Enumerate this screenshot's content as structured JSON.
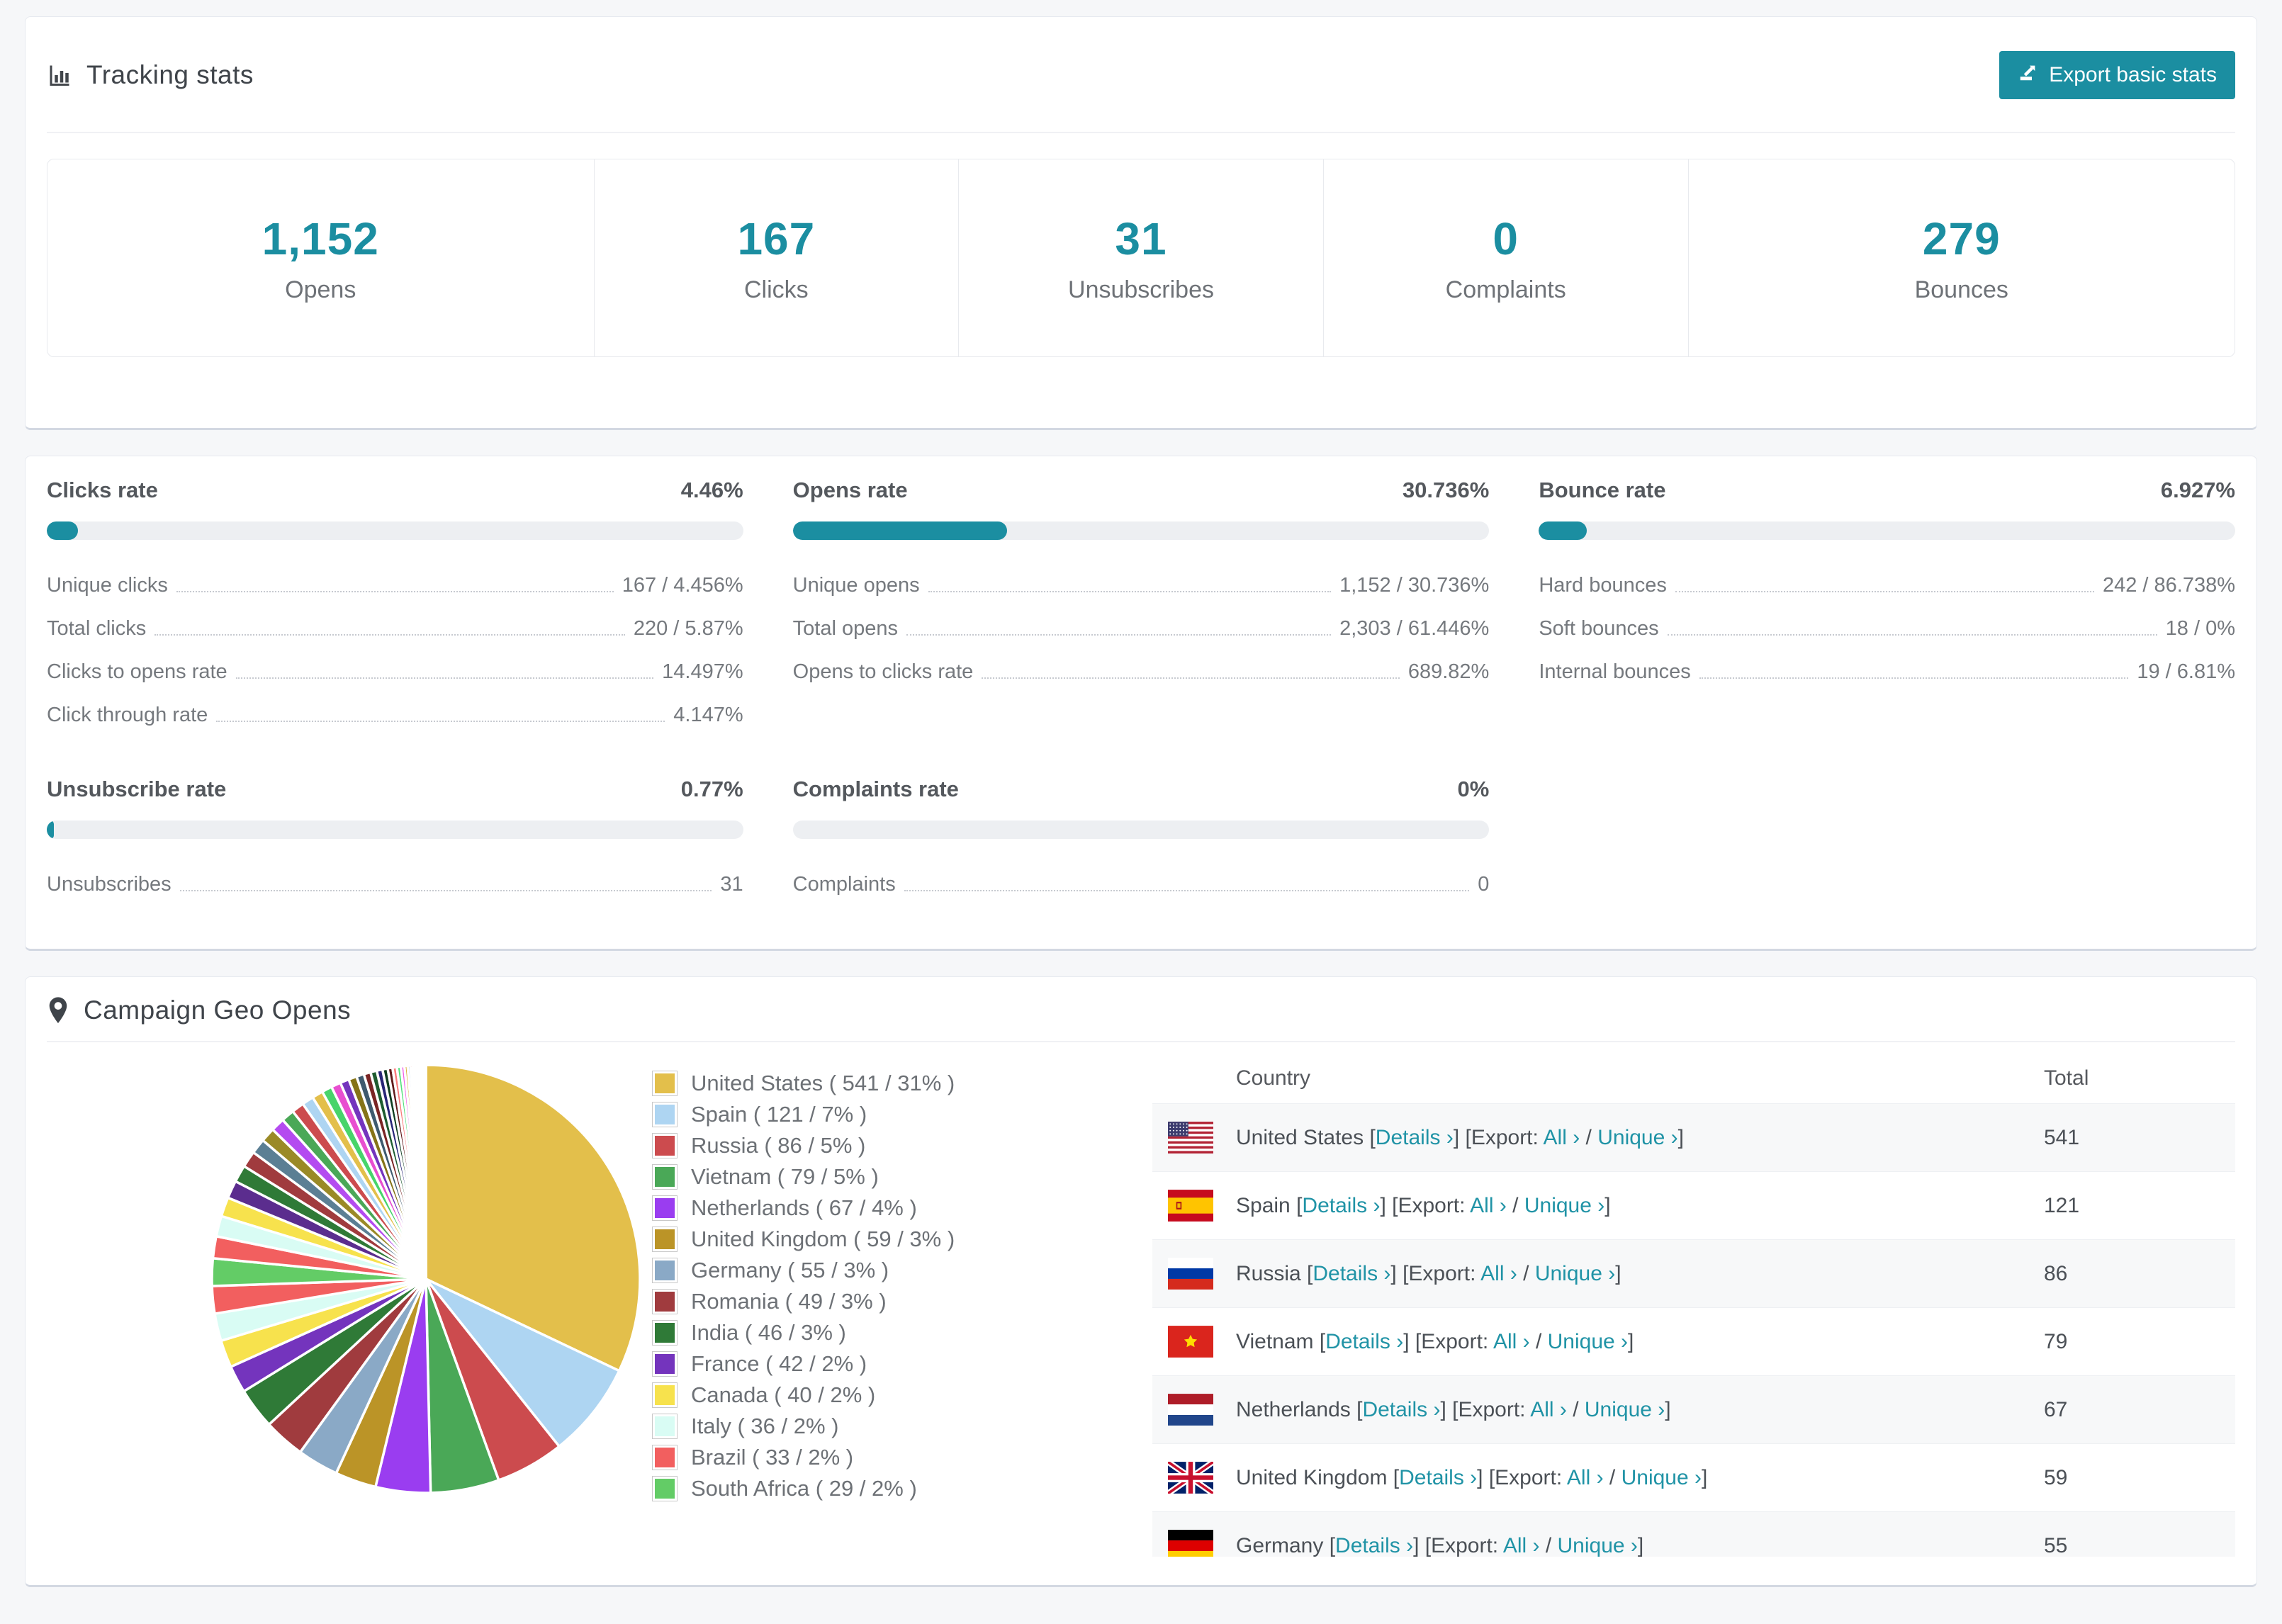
{
  "colors": {
    "accent": "#1b8ea1",
    "bar_track": "#edeff2",
    "stripe": "#f7f8f9",
    "link": "#2093a6"
  },
  "tracking": {
    "title": "Tracking stats",
    "export_button": "Export basic stats",
    "stats": [
      {
        "value": "1,152",
        "label": "Opens"
      },
      {
        "value": "167",
        "label": "Clicks"
      },
      {
        "value": "31",
        "label": "Unsubscribes"
      },
      {
        "value": "0",
        "label": "Complaints"
      },
      {
        "value": "279",
        "label": "Bounces"
      }
    ]
  },
  "rates": [
    {
      "title": "Clicks rate",
      "value": "4.46%",
      "percent": 4.46,
      "rows": [
        {
          "label": "Unique clicks",
          "value": "167 / 4.456%"
        },
        {
          "label": "Total clicks",
          "value": "220 / 5.87%"
        },
        {
          "label": "Clicks to opens rate",
          "value": "14.497%"
        },
        {
          "label": "Click through rate",
          "value": "4.147%"
        }
      ]
    },
    {
      "title": "Opens rate",
      "value": "30.736%",
      "percent": 30.736,
      "rows": [
        {
          "label": "Unique opens",
          "value": "1,152 / 30.736%"
        },
        {
          "label": "Total opens",
          "value": "2,303 / 61.446%"
        },
        {
          "label": "Opens to clicks rate",
          "value": "689.82%"
        }
      ]
    },
    {
      "title": "Bounce rate",
      "value": "6.927%",
      "percent": 6.927,
      "rows": [
        {
          "label": "Hard bounces",
          "value": "242 / 86.738%"
        },
        {
          "label": "Soft bounces",
          "value": "18 / 0%"
        },
        {
          "label": "Internal bounces",
          "value": "19 / 6.81%"
        }
      ]
    },
    {
      "title": "Unsubscribe rate",
      "value": "0.77%",
      "percent": 0.77,
      "rows": [
        {
          "label": "Unsubscribes",
          "value": "31"
        }
      ]
    },
    {
      "title": "Complaints rate",
      "value": "0%",
      "percent": 0,
      "rows": [
        {
          "label": "Complaints",
          "value": "0"
        }
      ]
    }
  ],
  "geo": {
    "title": "Campaign Geo Opens",
    "table": {
      "headers": [
        "Country",
        "Total"
      ],
      "links": {
        "details": "Details ›",
        "export_label": "Export:",
        "all": "All ›",
        "unique": "Unique ›"
      },
      "rows": [
        {
          "country": "United States",
          "flag": "us",
          "total": "541"
        },
        {
          "country": "Spain",
          "flag": "es",
          "total": "121"
        },
        {
          "country": "Russia",
          "flag": "ru",
          "total": "86"
        },
        {
          "country": "Vietnam",
          "flag": "vn",
          "total": "79"
        },
        {
          "country": "Netherlands",
          "flag": "nl",
          "total": "67"
        },
        {
          "country": "United Kingdom",
          "flag": "gb",
          "total": "59"
        },
        {
          "country": "Germany",
          "flag": "de",
          "total": "55"
        }
      ]
    }
  },
  "chart_data": {
    "type": "pie",
    "title": "Campaign Geo Opens",
    "legend_position": "right",
    "series": [
      {
        "label": "United States",
        "value": 541,
        "pct": 31,
        "color": "#e3bf4b"
      },
      {
        "label": "Spain",
        "value": 121,
        "pct": 7,
        "color": "#aed5f2"
      },
      {
        "label": "Russia",
        "value": 86,
        "pct": 5,
        "color": "#cc4b4e"
      },
      {
        "label": "Vietnam",
        "value": 79,
        "pct": 5,
        "color": "#4aa857"
      },
      {
        "label": "Netherlands",
        "value": 67,
        "pct": 4,
        "color": "#9a3df0"
      },
      {
        "label": "United Kingdom",
        "value": 59,
        "pct": 3,
        "color": "#bb9427"
      },
      {
        "label": "Germany",
        "value": 55,
        "pct": 3,
        "color": "#8aa9c6"
      },
      {
        "label": "Romania",
        "value": 49,
        "pct": 3,
        "color": "#a03b3e"
      },
      {
        "label": "India",
        "value": 46,
        "pct": 3,
        "color": "#2f7a37"
      },
      {
        "label": "France",
        "value": 42,
        "pct": 2,
        "color": "#7434bd"
      },
      {
        "label": "Canada",
        "value": 40,
        "pct": 2,
        "color": "#f7e24d"
      },
      {
        "label": "Italy",
        "value": 36,
        "pct": 2,
        "color": "#d9fcf4"
      },
      {
        "label": "Brazil",
        "value": 33,
        "pct": 2,
        "color": "#f25f5f"
      },
      {
        "label": "South Africa",
        "value": 29,
        "pct": 2,
        "color": "#63cc66"
      }
    ],
    "others_pcts": [
      1.6,
      1.5,
      1.4,
      1.3,
      1.25,
      1.2,
      1.1,
      1.05,
      1.0,
      0.95,
      0.9,
      0.85,
      0.8,
      0.75,
      0.7,
      0.65,
      0.6,
      0.55,
      0.5,
      0.46,
      0.42,
      0.38,
      0.35,
      0.32,
      0.29,
      0.26,
      0.23,
      0.2,
      0.18,
      0.16,
      0.14,
      0.12,
      0.1,
      0.09,
      0.08,
      0.07,
      0.06,
      0.05,
      0.04,
      0.03
    ],
    "others_colors": [
      "#f25f5f",
      "#d9fcf4",
      "#f7e24d",
      "#5b2d8e",
      "#2f7a37",
      "#a03b3e",
      "#5b7f94",
      "#9a8a27",
      "#b44bf0",
      "#4aa857",
      "#cc4b4e",
      "#aed5f2",
      "#e3bf4b",
      "#48d46a",
      "#e84fd0",
      "#7434bd",
      "#857318",
      "#3e5a6e",
      "#7a2525",
      "#1e5c30",
      "#282577",
      "#0f3d20",
      "#611a1a",
      "#fa7d7d",
      "#52e07c",
      "#f060e8",
      "#d4a928",
      "#9cc8ec",
      "#d64545",
      "#3da04b",
      "#8b3ce0",
      "#c9a53a",
      "#b8d8f0",
      "#e05555",
      "#35914a",
      "#7a3bd0",
      "#b09020",
      "#46657a",
      "#8a2f2f",
      "#245f35"
    ]
  }
}
